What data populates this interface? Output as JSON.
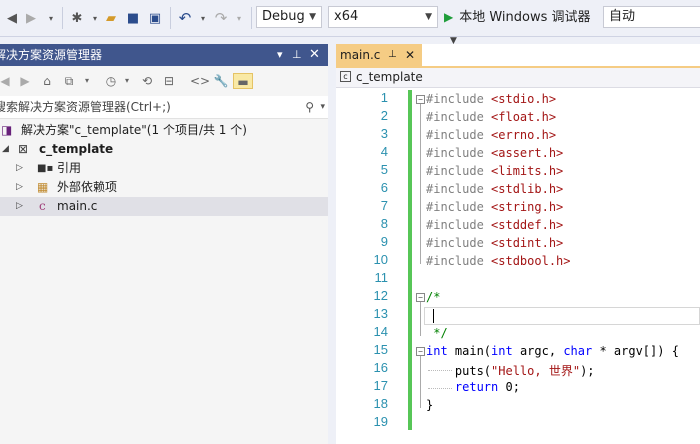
{
  "toolbar": {
    "config": "Debug",
    "platform": "x64",
    "run_label": "本地 Windows 调试器",
    "auto": "自动"
  },
  "solution_explorer": {
    "title": "解决方案资源管理器",
    "search_placeholder": "搜索解决方案资源管理器(Ctrl+;)",
    "tree": {
      "solution": "解决方案\"c_template\"(1 个项目/共 1 个)",
      "project": "c_template",
      "references": "引用",
      "external_deps": "外部依赖项",
      "file": "main.c"
    }
  },
  "editor": {
    "tab_label": "main.c",
    "nav_scope": "c_template",
    "lines": [
      {
        "n": "1",
        "pp": "#include ",
        "str": "<stdio.h>"
      },
      {
        "n": "2",
        "pp": "#include ",
        "str": "<float.h>"
      },
      {
        "n": "3",
        "pp": "#include ",
        "str": "<errno.h>"
      },
      {
        "n": "4",
        "pp": "#include ",
        "str": "<assert.h>"
      },
      {
        "n": "5",
        "pp": "#include ",
        "str": "<limits.h>"
      },
      {
        "n": "6",
        "pp": "#include ",
        "str": "<stdlib.h>"
      },
      {
        "n": "7",
        "pp": "#include ",
        "str": "<string.h>"
      },
      {
        "n": "8",
        "pp": "#include ",
        "str": "<stddef.h>"
      },
      {
        "n": "9",
        "pp": "#include ",
        "str": "<stdint.h>"
      },
      {
        "n": "10",
        "pp": "#include ",
        "str": "<stdbool.h>"
      },
      {
        "n": "11"
      },
      {
        "n": "12",
        "cm": "/*"
      },
      {
        "n": "13"
      },
      {
        "n": "14",
        "cm": " */"
      },
      {
        "n": "15",
        "kw": "int",
        "rest": " main(",
        "kw2": "int",
        "rest2": " argc, ",
        "kw3": "char",
        "rest3": " * argv[]) {"
      },
      {
        "n": "16",
        "pre": "    puts(",
        "str": "\"Hello, 世界\"",
        "post": ");"
      },
      {
        "n": "17",
        "pre": "    ",
        "kw": "return",
        "post": " 0;"
      },
      {
        "n": "18",
        "pre": "}"
      },
      {
        "n": "19"
      }
    ]
  }
}
